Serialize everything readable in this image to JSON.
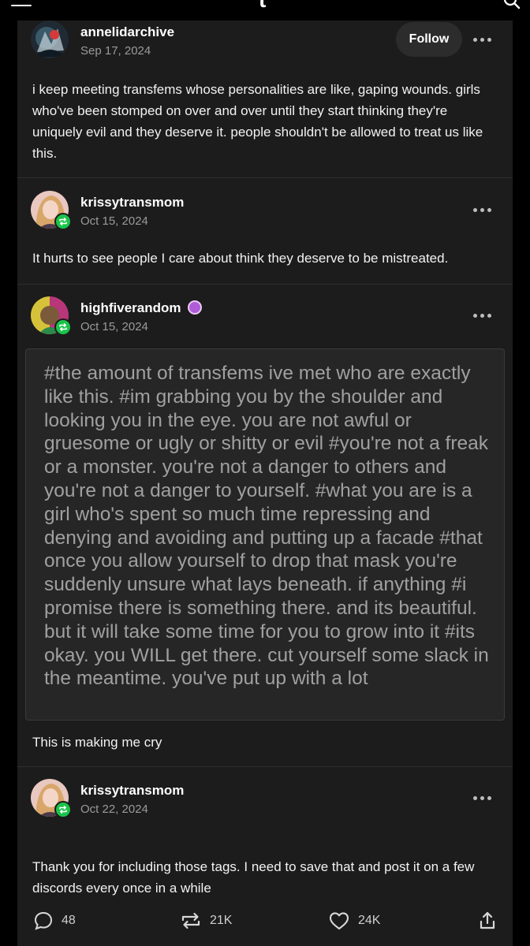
{
  "header": {
    "logo": "t"
  },
  "thread": [
    {
      "username": "annelidarchive",
      "date": "Sep 17, 2024",
      "follow_label": "Follow",
      "text": "i keep meeting transfems whose personalities are like, gaping wounds. girls who've been stomped on over and over until they start thinking they're uniquely evil and they deserve it. people shouldn't be allowed to treat us like this."
    },
    {
      "username": "krissytransmom",
      "date": "Oct 15, 2024",
      "text": "It hurts to see people I care about think they deserve to be mistreated."
    },
    {
      "username": "highfiverandom",
      "date": "Oct 15, 2024",
      "tags_text": "#the amount of transfems ive met who are exactly like this.  #im grabbing you by the shoulder and looking you in the eye. you are not awful or gruesome or ugly or shitty or evil  #you're not a freak or a monster. you're not a danger to others and you're not a danger to yourself.  #what you are is a girl who's spent so much time repressing and denying and avoiding and putting up a facade  #that once you allow yourself to drop that mask you're suddenly unsure what lays beneath. if anything  #i promise there is something there. and its beautiful. but it will take some time for you to grow into it  #its okay. you WILL get there. cut yourself some slack in the meantime. you've put up with a lot",
      "text": "This is making me cry"
    },
    {
      "username": "krissytransmom",
      "date": "Oct 22, 2024",
      "text": "Thank you for including those tags.  I need to save that and post it on a few discords every once in a while"
    }
  ],
  "actions": {
    "comments": "48",
    "reblogs": "21K",
    "likes": "24K"
  },
  "colors": {
    "background": "#000000",
    "card": "#1c1c1c",
    "reblog_green": "#1ac44a",
    "muted_text": "#9a9a9a"
  }
}
